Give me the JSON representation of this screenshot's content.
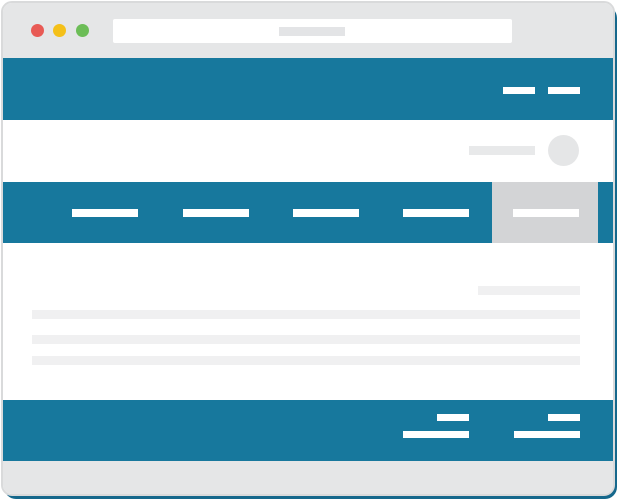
{
  "window": {
    "controls": [
      {
        "name": "close",
        "color": "#e85a55"
      },
      {
        "name": "minimize",
        "color": "#f4c019"
      },
      {
        "name": "maximize",
        "color": "#6cbd57"
      }
    ]
  },
  "colors": {
    "primary": "#17789d",
    "chrome": "#e5e6e7",
    "active_tab": "#d3d4d6",
    "placeholder_text": "#f0f0f1"
  },
  "topbar": {
    "links": [
      "",
      ""
    ]
  },
  "header": {
    "user_name": "",
    "avatar_icon": "user-avatar-icon"
  },
  "navbar": {
    "tabs": [
      {
        "label": "",
        "active": false
      },
      {
        "label": "",
        "active": false
      },
      {
        "label": "",
        "active": false
      },
      {
        "label": "",
        "active": false
      },
      {
        "label": "",
        "active": true
      }
    ]
  },
  "content": {
    "heading": "",
    "paragraphs": [
      "",
      "",
      ""
    ]
  },
  "footer": {
    "columns": [
      {
        "title": "",
        "link": ""
      },
      {
        "title": "",
        "link": ""
      }
    ]
  }
}
